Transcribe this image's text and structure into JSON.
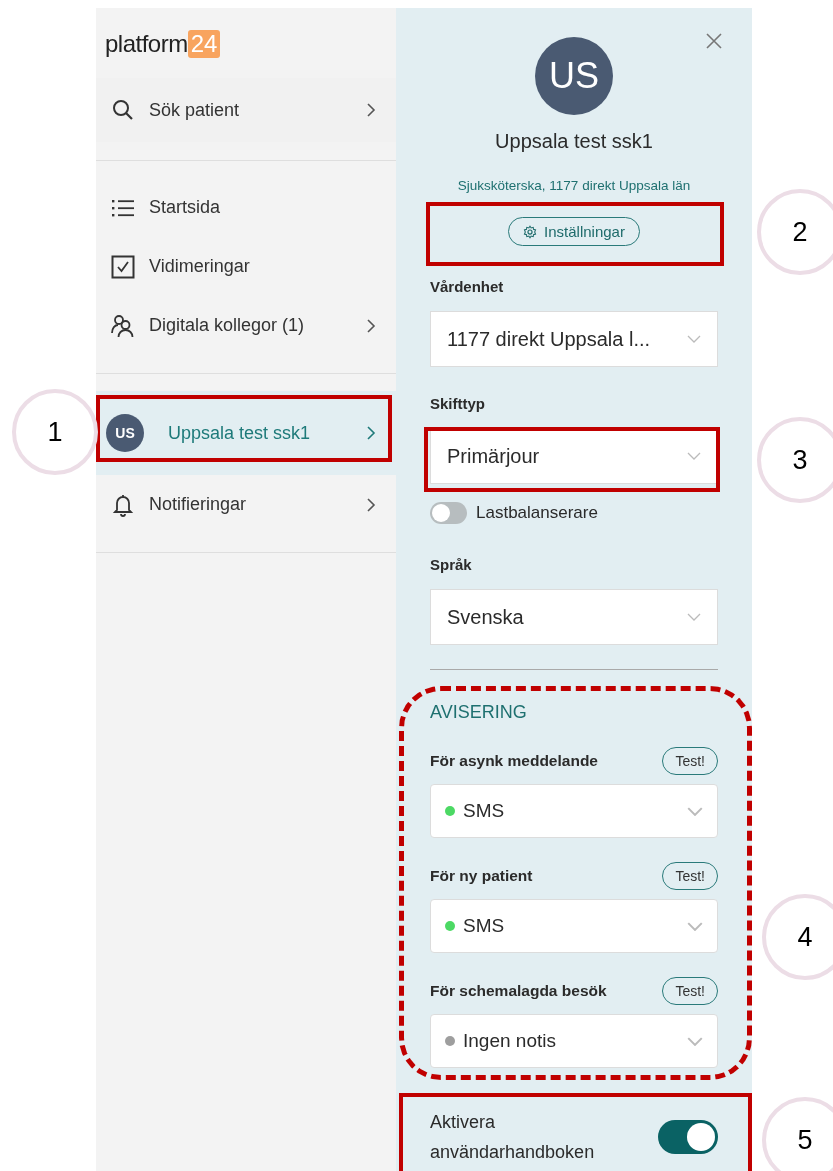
{
  "logo": {
    "text": "platform",
    "badge": "24"
  },
  "sidebar": {
    "groups": [
      {
        "items": [
          {
            "kind": "search",
            "label": "Sök patient",
            "chevron": true,
            "selected": false
          }
        ]
      },
      {
        "items": [
          {
            "kind": "list",
            "label": "Startsida",
            "chevron": false,
            "selected": false
          },
          {
            "kind": "checkbox",
            "label": "Vidimeringar",
            "chevron": false,
            "selected": false
          },
          {
            "kind": "people",
            "label": "Digitala kollegor (1)",
            "chevron": true,
            "selected": false
          }
        ]
      },
      {
        "items": [
          {
            "kind": "avatar",
            "initials": "US",
            "label": "Uppsala test ssk1",
            "chevron": true,
            "selected": true
          },
          {
            "kind": "bell",
            "label": "Notifieringar",
            "chevron": true,
            "selected": false
          }
        ]
      }
    ]
  },
  "panel": {
    "avatar": "US",
    "name": "Uppsala test ssk1",
    "role": "Sjuksköterska, 1177 direkt Uppsala län",
    "settings_button": "Inställningar",
    "unit": {
      "label": "Vårdenhet",
      "value": "1177 direkt Uppsala l..."
    },
    "shift": {
      "label": "Skifttyp",
      "value": "Primärjour"
    },
    "load_balancer": {
      "label": "Lastbalanserare",
      "on": false
    },
    "language": {
      "label": "Språk",
      "value": "Svenska"
    },
    "notifications": {
      "heading": "AVISERING",
      "items": [
        {
          "label": "För asynk meddelande",
          "test": "Test!",
          "value": "SMS",
          "color": "#4cd964"
        },
        {
          "label": "För ny patient",
          "test": "Test!",
          "value": "SMS",
          "color": "#4cd964"
        },
        {
          "label": "För schemalagda besök",
          "test": "Test!",
          "value": "Ingen notis",
          "color": "#9e9e9e"
        }
      ]
    },
    "guide": {
      "label": "Aktivera användarhandboken",
      "on": true
    }
  },
  "callouts": [
    {
      "number": "1"
    },
    {
      "number": "2"
    },
    {
      "number": "3"
    },
    {
      "number": "4"
    },
    {
      "number": "5"
    }
  ]
}
